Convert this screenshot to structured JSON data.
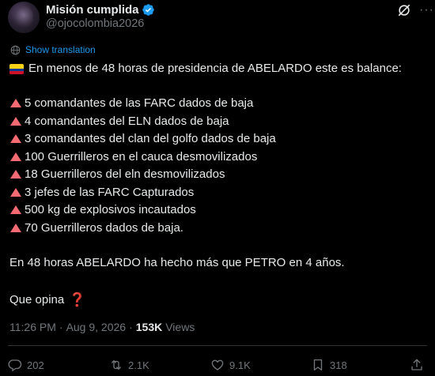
{
  "author": {
    "display_name": "Misión cumplida",
    "handle": "@ojocolombia2026",
    "verified": true
  },
  "post": {
    "show_translation_label": "Show translation",
    "intro": "En menos de 48 horas de presidencia de ABELARDO este es balance:",
    "bullets": [
      "5 comandantes de las FARC dados de baja",
      "4 comandantes del ELN dados de baja",
      "3 comandantes del  clan del golfo dados de baja",
      "100 Guerrilleros en el cauca desmovilizados",
      "18 Guerrilleros del eln desmovilizados",
      "3 jefes de las FARC Capturados",
      "500 kg de explosivos incautados",
      "70 Guerrilleros dados de baja."
    ],
    "conclusion": "En 48 horas ABELARDO ha hecho más que PETRO en 4 años.",
    "question": "Que opina",
    "question_emoji": "❓"
  },
  "meta": {
    "time": "11:26 PM",
    "separator": "·",
    "date": "Aug 9, 2026",
    "views_count": "153K",
    "views_label": "Views"
  },
  "actions": {
    "replies": "202",
    "reposts": "2.1K",
    "likes": "9.1K",
    "bookmarks": "318"
  },
  "icons": {
    "intro_flag": "colombia-flag-icon",
    "bullet": "red-triangle-icon",
    "translate": "globe-icon",
    "grok": "grok-icon",
    "more": "more-icon"
  },
  "colors": {
    "accent": "#1d9bf0",
    "text": "#e7e9ea",
    "muted": "#71767b",
    "background": "#000000",
    "bullet": "#f36a73"
  }
}
